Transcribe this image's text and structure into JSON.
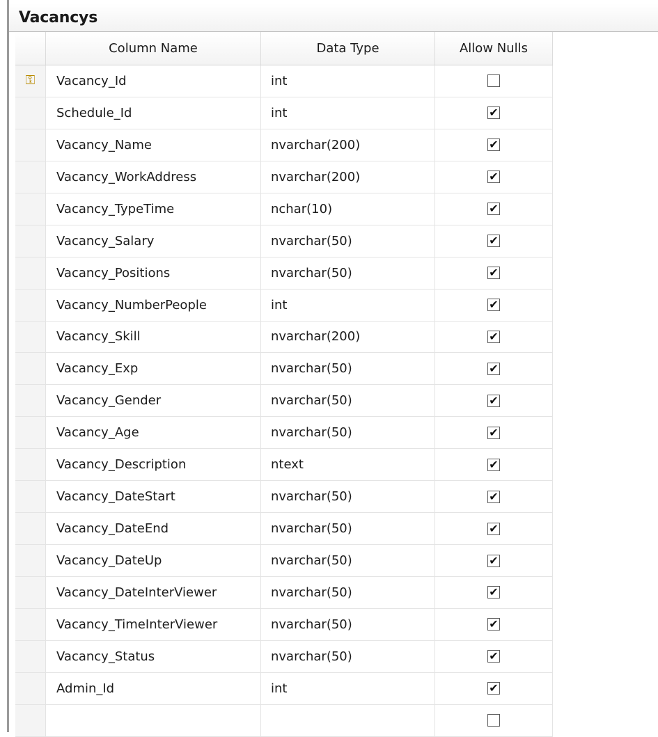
{
  "table": {
    "title": "Vacancys",
    "headers": {
      "column_name": "Column Name",
      "data_type": "Data Type",
      "allow_nulls": "Allow Nulls"
    },
    "primary_key_icon": "key-icon",
    "columns": [
      {
        "name": "Vacancy_Id",
        "type": "int",
        "allow_nulls": false,
        "primary_key": true
      },
      {
        "name": "Schedule_Id",
        "type": "int",
        "allow_nulls": true
      },
      {
        "name": "Vacancy_Name",
        "type": "nvarchar(200)",
        "allow_nulls": true
      },
      {
        "name": "Vacancy_WorkAddress",
        "type": "nvarchar(200)",
        "allow_nulls": true
      },
      {
        "name": "Vacancy_TypeTime",
        "type": "nchar(10)",
        "allow_nulls": true
      },
      {
        "name": "Vacancy_Salary",
        "type": "nvarchar(50)",
        "allow_nulls": true
      },
      {
        "name": "Vacancy_Positions",
        "type": "nvarchar(50)",
        "allow_nulls": true
      },
      {
        "name": "Vacancy_NumberPeople",
        "type": "int",
        "allow_nulls": true
      },
      {
        "name": "Vacancy_Skill",
        "type": "nvarchar(200)",
        "allow_nulls": true
      },
      {
        "name": "Vacancy_Exp",
        "type": "nvarchar(50)",
        "allow_nulls": true
      },
      {
        "name": "Vacancy_Gender",
        "type": "nvarchar(50)",
        "allow_nulls": true
      },
      {
        "name": "Vacancy_Age",
        "type": "nvarchar(50)",
        "allow_nulls": true
      },
      {
        "name": "Vacancy_Description",
        "type": "ntext",
        "allow_nulls": true
      },
      {
        "name": "Vacancy_DateStart",
        "type": "nvarchar(50)",
        "allow_nulls": true
      },
      {
        "name": "Vacancy_DateEnd",
        "type": "nvarchar(50)",
        "allow_nulls": true
      },
      {
        "name": "Vacancy_DateUp",
        "type": "nvarchar(50)",
        "allow_nulls": true
      },
      {
        "name": "Vacancy_DateInterViewer",
        "type": "nvarchar(50)",
        "allow_nulls": true
      },
      {
        "name": "Vacancy_TimeInterViewer",
        "type": "nvarchar(50)",
        "allow_nulls": true
      },
      {
        "name": "Vacancy_Status",
        "type": "nvarchar(50)",
        "allow_nulls": true
      },
      {
        "name": "Admin_Id",
        "type": "int",
        "allow_nulls": true
      },
      {
        "name": "",
        "type": "",
        "allow_nulls": false
      }
    ]
  }
}
